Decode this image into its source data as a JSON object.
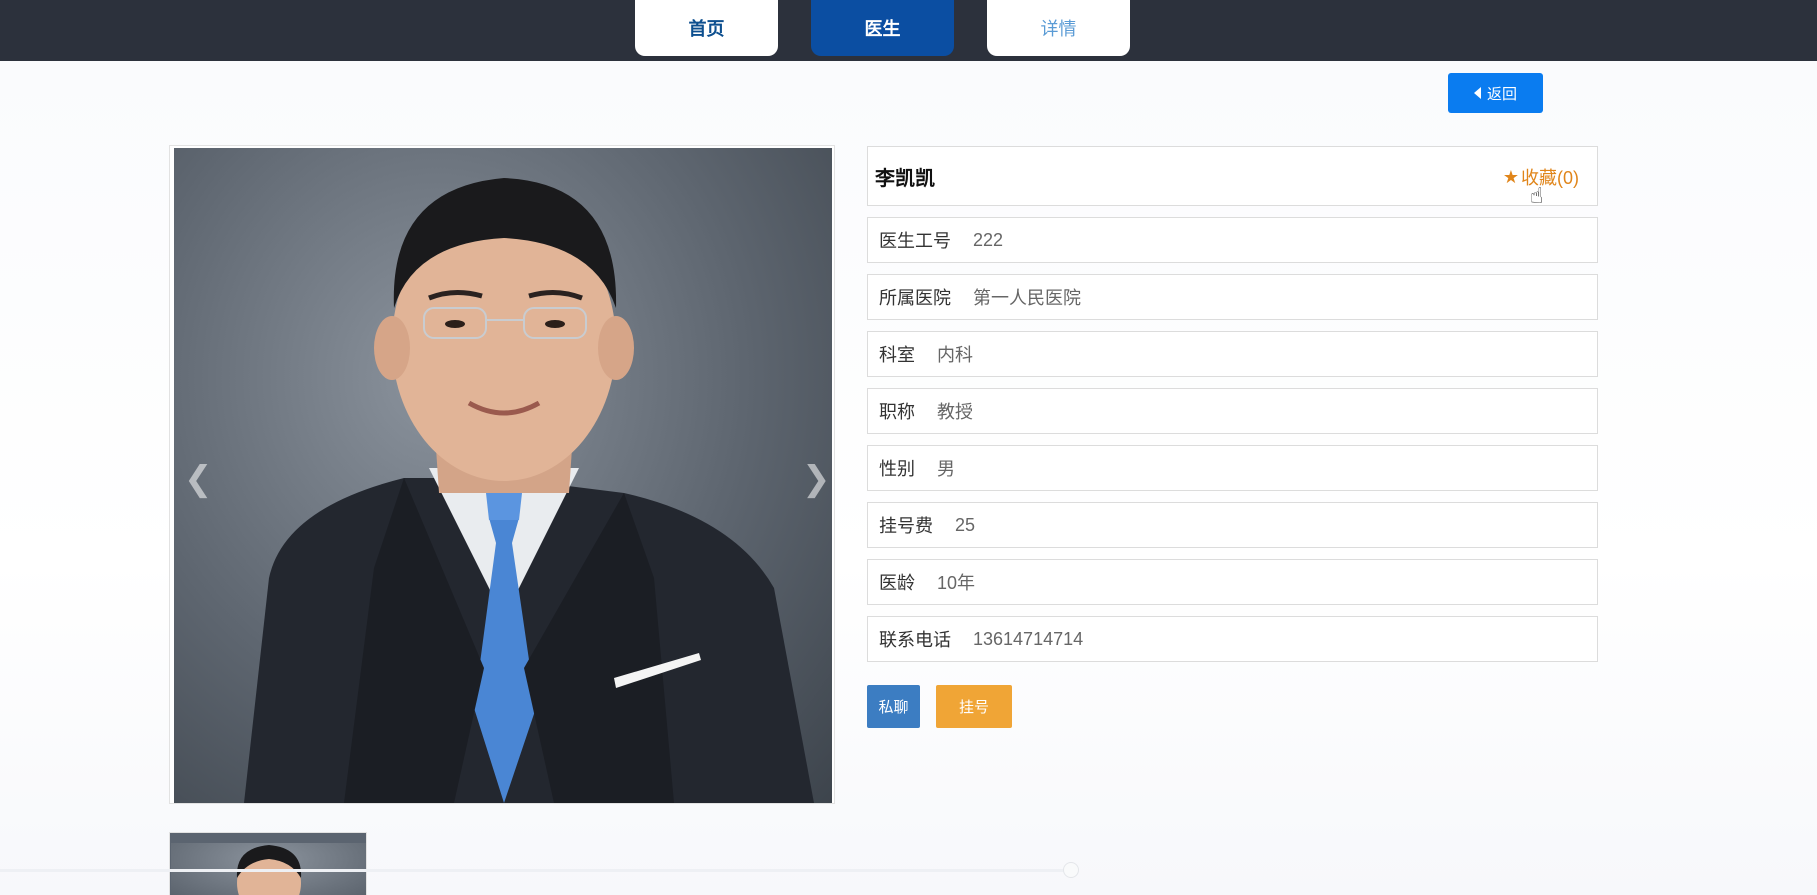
{
  "nav": {
    "tabs": [
      {
        "label": "首页"
      },
      {
        "label": "医生"
      },
      {
        "label": "详情"
      }
    ]
  },
  "back_button": {
    "label": "返回"
  },
  "doctor": {
    "name": "李凯凯",
    "favorite_label": "收藏(0)",
    "fields": [
      {
        "label": "医生工号",
        "value": "222"
      },
      {
        "label": "所属医院",
        "value": "第一人民医院"
      },
      {
        "label": "科室",
        "value": "内科"
      },
      {
        "label": "职称",
        "value": "教授"
      },
      {
        "label": "性别",
        "value": "男"
      },
      {
        "label": "挂号费",
        "value": "25"
      },
      {
        "label": "医龄",
        "value": "10年"
      },
      {
        "label": "联系电话",
        "value": "13614714714"
      }
    ]
  },
  "actions": {
    "chat_label": "私聊",
    "register_label": "挂号"
  },
  "gallery": {
    "prev_icon": "chevron-left-icon",
    "next_icon": "chevron-right-icon"
  },
  "colors": {
    "topbar": "#2c313c",
    "active_tab": "#0b4ea2",
    "back_button": "#0a7cf0",
    "favorite": "#e0851a",
    "chat_button": "#3c7dc2",
    "register_button": "#f0a536"
  }
}
